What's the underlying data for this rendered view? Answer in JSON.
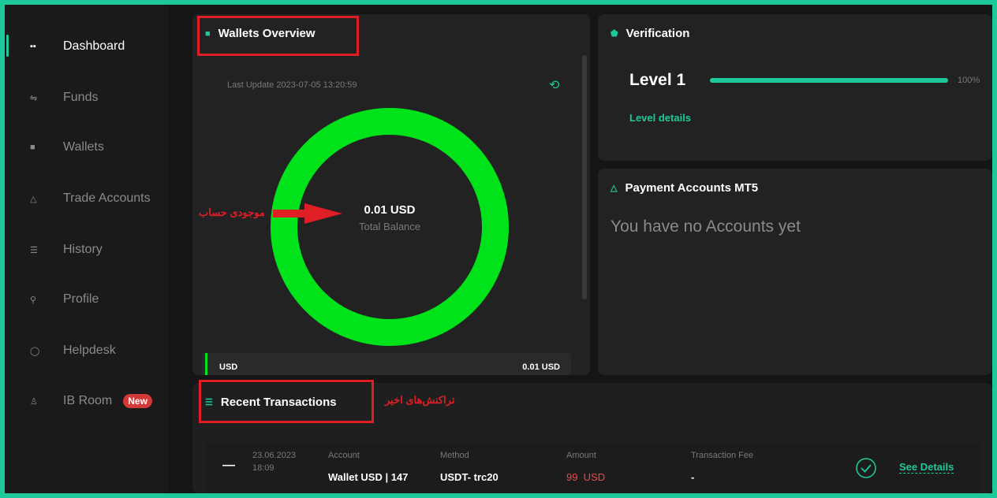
{
  "sidebar": {
    "items": [
      {
        "icon": "dashboard-icon",
        "glyph": "▪▪",
        "label": "Dashboard",
        "active": true
      },
      {
        "icon": "funds-icon",
        "glyph": "⇋",
        "label": "Funds"
      },
      {
        "icon": "wallet-icon",
        "glyph": "■",
        "label": "Wallets"
      },
      {
        "icon": "trade-icon",
        "glyph": "△",
        "label": "Trade Accounts"
      },
      {
        "icon": "history-icon",
        "glyph": "☰",
        "label": "History"
      },
      {
        "icon": "profile-icon",
        "glyph": "⚲",
        "label": "Profile"
      },
      {
        "icon": "helpdesk-icon",
        "glyph": "◯",
        "label": "Helpdesk"
      },
      {
        "icon": "ibroom-icon",
        "glyph": "♙",
        "label": "IB Room",
        "badge": "New"
      }
    ]
  },
  "wallets": {
    "title": "Wallets Overview",
    "last_update": "Last Update 2023-07-05 13:20:59",
    "balance": "0.01 USD",
    "balance_label": "Total Balance",
    "annotation": "موجودی حساب",
    "legend_currency": "USD",
    "legend_value": "0.01 USD",
    "ring_color": "#00e21a"
  },
  "verification": {
    "title": "Verification",
    "level": "Level 1",
    "progress_percent": 100,
    "progress_text": "100%",
    "details_link": "Level details"
  },
  "payment": {
    "title": "Payment Accounts MT5",
    "empty": "You have no Accounts yet"
  },
  "transactions": {
    "title": "Recent Transactions",
    "annotation": "تراکنش‌های اخیر",
    "row": {
      "date": "23.06.2023",
      "time": "18:09",
      "account_label": "Account",
      "account": "Wallet USD | 147",
      "method_label": "Method",
      "method": "USDT- trc20",
      "amount_label": "Amount",
      "amount": "99  USD",
      "fee_label": "Transaction Fee",
      "fee": "-",
      "details": "See Details"
    }
  },
  "colors": {
    "accent": "#1dc99a",
    "annotation": "#e01e25",
    "amount": "#e74c4c"
  }
}
